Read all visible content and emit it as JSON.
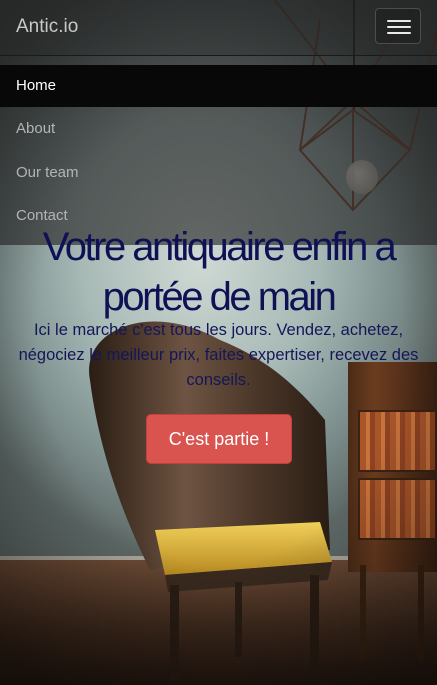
{
  "navbar": {
    "brand": "Antic.io",
    "menu_items": [
      {
        "label": "Home",
        "active": true
      },
      {
        "label": "About",
        "active": false
      },
      {
        "label": "Our team",
        "active": false
      },
      {
        "label": "Contact",
        "active": false
      }
    ]
  },
  "hero": {
    "headline": "Votre antiquaire enfin a portée de main",
    "subtext": "Ici le marché c'est tous les jours. Vendez, achetez, négociez le meilleur prix, faites expertiser, recevez des conseils.",
    "cta_label": "C'est partie !"
  },
  "icons": {
    "toggler": "hamburger-menu-icon"
  },
  "colors": {
    "headline": "#0f1154",
    "cta_background": "#d9534f",
    "navbar_background": "#222222",
    "active_item_background": "#080808"
  }
}
